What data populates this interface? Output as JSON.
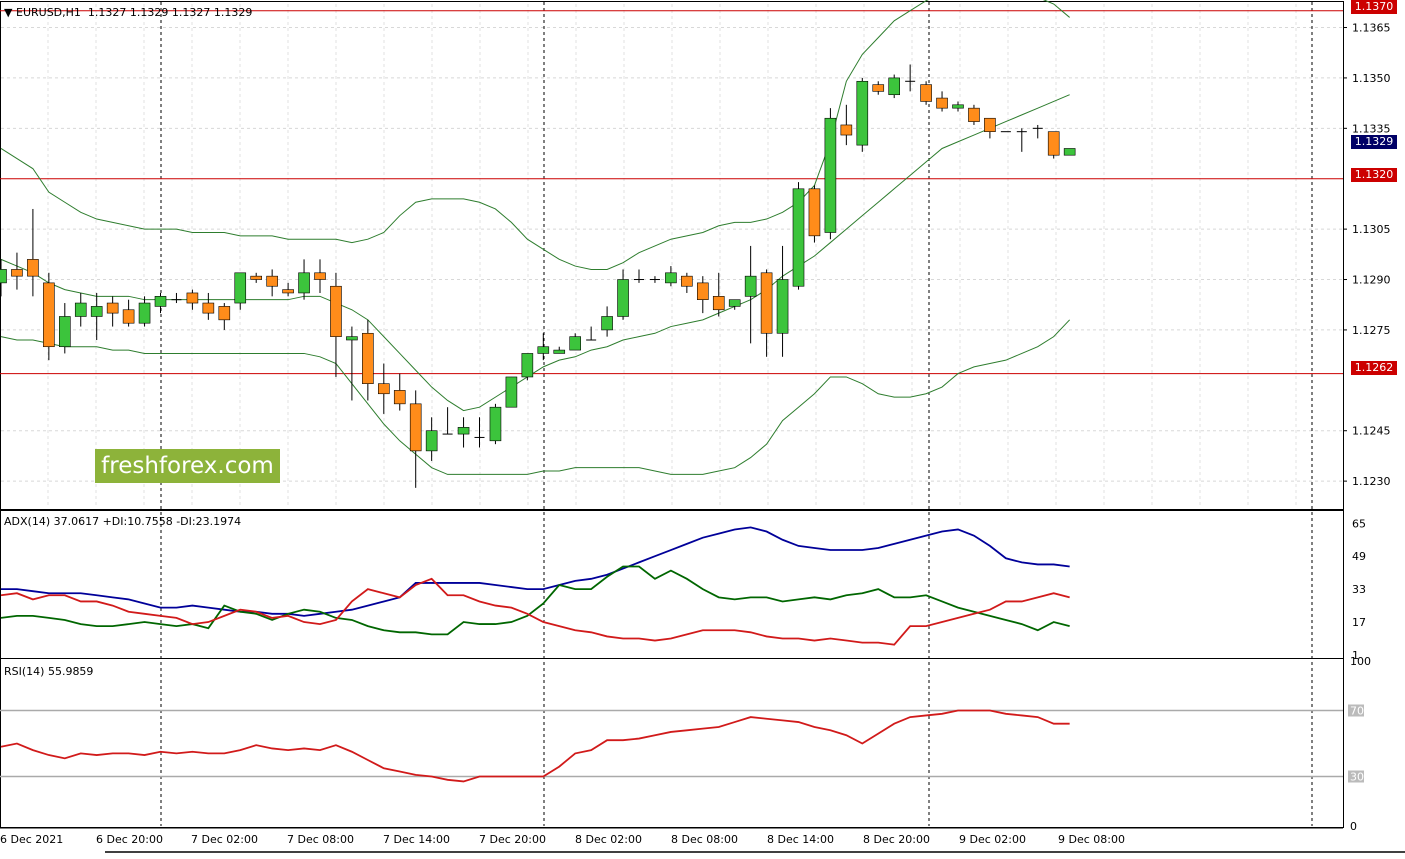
{
  "header": {
    "symbol_line": "EURUSD,H1  1.1327 1.1329 1.1327 1.1329",
    "adx_line": "ADX(14) 37.0617 +DI:10.7558 -DI:23.1974",
    "rsi_line": "RSI(14) 55.9859"
  },
  "watermark": "freshforex.com",
  "price_tags": {
    "top": "1.1370",
    "current": "1.1329",
    "resistance": "1.1320",
    "support": "1.1262"
  },
  "colors": {
    "bull": "#3cc43c",
    "bear": "#ff8c1a",
    "band": "#2e7d2e",
    "level": "#cc0000",
    "adx": "#000099",
    "plus_di": "#006600",
    "minus_di": "#d11a1a",
    "rsi": "#d11a1a",
    "current_tag": "#000066"
  },
  "chart_data": [
    {
      "type": "candlestick",
      "symbol": "EURUSD",
      "timeframe": "H1",
      "ylim": [
        1.1222,
        1.1372
      ],
      "yticks": [
        "1.1365",
        "1.1350",
        "1.1335",
        "1.1305",
        "1.1290",
        "1.1275",
        "1.1245",
        "1.1230"
      ],
      "xticks": [
        "6 Dec 2021",
        "6 Dec 20:00",
        "7 Dec 02:00",
        "7 Dec 08:00",
        "7 Dec 14:00",
        "7 Dec 20:00",
        "8 Dec 02:00",
        "8 Dec 08:00",
        "8 Dec 14:00",
        "8 Dec 20:00",
        "9 Dec 02:00",
        "9 Dec 08:00"
      ],
      "levels": [
        1.137,
        1.132,
        1.1262
      ],
      "candles": [
        [
          1.1289,
          1.1296,
          1.1285,
          1.1293
        ],
        [
          1.1293,
          1.1298,
          1.1287,
          1.1291
        ],
        [
          1.1296,
          1.1311,
          1.1285,
          1.1291
        ],
        [
          1.1289,
          1.1292,
          1.1266,
          1.127
        ],
        [
          1.127,
          1.1283,
          1.1268,
          1.1279
        ],
        [
          1.1279,
          1.1286,
          1.1276,
          1.1283
        ],
        [
          1.1279,
          1.1286,
          1.1272,
          1.1282
        ],
        [
          1.1283,
          1.1285,
          1.1276,
          1.128
        ],
        [
          1.1281,
          1.1284,
          1.1276,
          1.1277
        ],
        [
          1.1277,
          1.1285,
          1.1276,
          1.1283
        ],
        [
          1.1282,
          1.1286,
          1.128,
          1.1285
        ],
        [
          1.1284,
          1.1286,
          1.1283,
          1.1284
        ],
        [
          1.1286,
          1.1287,
          1.1281,
          1.1283
        ],
        [
          1.1283,
          1.1286,
          1.1278,
          1.128
        ],
        [
          1.1282,
          1.1283,
          1.1275,
          1.1278
        ],
        [
          1.1283,
          1.1292,
          1.1281,
          1.1292
        ],
        [
          1.1291,
          1.1292,
          1.1289,
          1.129
        ],
        [
          1.1291,
          1.1293,
          1.1285,
          1.1288
        ],
        [
          1.1287,
          1.1289,
          1.1285,
          1.1286
        ],
        [
          1.1286,
          1.1296,
          1.1284,
          1.1292
        ],
        [
          1.1292,
          1.1296,
          1.1286,
          1.129
        ],
        [
          1.1288,
          1.1292,
          1.1261,
          1.1273
        ],
        [
          1.1272,
          1.1276,
          1.1254,
          1.1273
        ],
        [
          1.1274,
          1.1278,
          1.1254,
          1.1259
        ],
        [
          1.1259,
          1.1265,
          1.125,
          1.1256
        ],
        [
          1.1257,
          1.1262,
          1.1251,
          1.1253
        ],
        [
          1.1253,
          1.1257,
          1.1228,
          1.1239
        ],
        [
          1.1239,
          1.1249,
          1.1236,
          1.1245
        ],
        [
          1.1244,
          1.1252,
          1.1244,
          1.1244
        ],
        [
          1.1244,
          1.1249,
          1.124,
          1.1246
        ],
        [
          1.1243,
          1.1249,
          1.124,
          1.1243
        ],
        [
          1.1242,
          1.1253,
          1.1241,
          1.1252
        ],
        [
          1.1252,
          1.1261,
          1.1252,
          1.1261
        ],
        [
          1.1261,
          1.1268,
          1.126,
          1.1268
        ],
        [
          1.1268,
          1.1274,
          1.1266,
          1.127
        ],
        [
          1.1268,
          1.127,
          1.1268,
          1.1269
        ],
        [
          1.1269,
          1.1274,
          1.1269,
          1.1273
        ],
        [
          1.1272,
          1.1276,
          1.1272,
          1.1272
        ],
        [
          1.1275,
          1.1282,
          1.1273,
          1.1279
        ],
        [
          1.1279,
          1.1293,
          1.1278,
          1.129
        ],
        [
          1.129,
          1.1293,
          1.1289,
          1.129
        ],
        [
          1.129,
          1.1291,
          1.1289,
          1.129
        ],
        [
          1.1289,
          1.1294,
          1.1288,
          1.1292
        ],
        [
          1.1291,
          1.1292,
          1.1286,
          1.1288
        ],
        [
          1.1289,
          1.1291,
          1.128,
          1.1284
        ],
        [
          1.1285,
          1.1292,
          1.1279,
          1.1281
        ],
        [
          1.1282,
          1.1284,
          1.1281,
          1.1284
        ],
        [
          1.1285,
          1.13,
          1.1271,
          1.1291
        ],
        [
          1.1292,
          1.1293,
          1.1267,
          1.1274
        ],
        [
          1.1274,
          1.13,
          1.1267,
          1.129
        ],
        [
          1.1288,
          1.1319,
          1.1287,
          1.1317
        ],
        [
          1.1317,
          1.1318,
          1.1301,
          1.1303
        ],
        [
          1.1304,
          1.1341,
          1.1302,
          1.1338
        ],
        [
          1.1336,
          1.1342,
          1.133,
          1.1333
        ],
        [
          1.133,
          1.135,
          1.1328,
          1.1349
        ],
        [
          1.1348,
          1.1349,
          1.1345,
          1.1346
        ],
        [
          1.1345,
          1.1351,
          1.1344,
          1.135
        ],
        [
          1.1349,
          1.1354,
          1.1346,
          1.1349
        ],
        [
          1.1348,
          1.1349,
          1.1342,
          1.1343
        ],
        [
          1.1344,
          1.1346,
          1.134,
          1.1341
        ],
        [
          1.1341,
          1.1343,
          1.134,
          1.1342
        ],
        [
          1.1341,
          1.1342,
          1.1336,
          1.1337
        ],
        [
          1.1338,
          1.1338,
          1.1332,
          1.1334
        ],
        [
          1.1334,
          1.1334,
          1.1334,
          1.1334
        ],
        [
          1.1334,
          1.1335,
          1.1328,
          1.1334
        ],
        [
          1.1335,
          1.1336,
          1.1332,
          1.1335
        ],
        [
          1.1334,
          1.1334,
          1.1326,
          1.1327
        ],
        [
          1.1327,
          1.1329,
          1.1327,
          1.1329
        ]
      ],
      "bollinger": {
        "upper": [
          1.1329,
          1.1326,
          1.1323,
          1.1316,
          1.1313,
          1.131,
          1.1308,
          1.1307,
          1.1306,
          1.1305,
          1.1305,
          1.1305,
          1.1304,
          1.1304,
          1.1304,
          1.1303,
          1.1303,
          1.1303,
          1.1302,
          1.1302,
          1.1302,
          1.1302,
          1.1301,
          1.1302,
          1.1304,
          1.1309,
          1.1313,
          1.1314,
          1.1314,
          1.1314,
          1.1313,
          1.1311,
          1.1307,
          1.1302,
          1.1299,
          1.1296,
          1.1294,
          1.1293,
          1.1293,
          1.1295,
          1.1298,
          1.13,
          1.1302,
          1.1303,
          1.1304,
          1.1306,
          1.1307,
          1.1307,
          1.1308,
          1.131,
          1.1313,
          1.1318,
          1.1331,
          1.1349,
          1.1357,
          1.1362,
          1.1367,
          1.137,
          1.1373,
          1.1375,
          1.1376,
          1.1377,
          1.1377,
          1.1377,
          1.1376,
          1.1374,
          1.1372,
          1.1368
        ],
        "middle": [
          1.1296,
          1.1294,
          1.1292,
          1.1289,
          1.1287,
          1.1286,
          1.1285,
          1.1285,
          1.1285,
          1.1284,
          1.1284,
          1.1284,
          1.1284,
          1.1284,
          1.1284,
          1.1284,
          1.1284,
          1.1284,
          1.1284,
          1.1285,
          1.1285,
          1.1283,
          1.1281,
          1.1278,
          1.1273,
          1.1268,
          1.1263,
          1.1258,
          1.1254,
          1.1251,
          1.1252,
          1.1255,
          1.1258,
          1.1261,
          1.1264,
          1.1266,
          1.1267,
          1.1269,
          1.127,
          1.1272,
          1.1273,
          1.1274,
          1.1276,
          1.1277,
          1.1278,
          1.128,
          1.1282,
          1.1284,
          1.1287,
          1.1291,
          1.1294,
          1.1297,
          1.1301,
          1.1305,
          1.1309,
          1.1313,
          1.1317,
          1.1321,
          1.1325,
          1.1329,
          1.1331,
          1.1333,
          1.1335,
          1.1337,
          1.1339,
          1.1341,
          1.1343,
          1.1345
        ],
        "lower": [
          1.1273,
          1.1272,
          1.1272,
          1.1271,
          1.127,
          1.127,
          1.127,
          1.1269,
          1.1269,
          1.1268,
          1.1268,
          1.1268,
          1.1268,
          1.1268,
          1.1268,
          1.1268,
          1.1268,
          1.1268,
          1.1268,
          1.1268,
          1.1267,
          1.1265,
          1.1259,
          1.1253,
          1.1247,
          1.1242,
          1.1238,
          1.1234,
          1.1232,
          1.1232,
          1.1232,
          1.1232,
          1.1232,
          1.1232,
          1.1233,
          1.1233,
          1.1234,
          1.1234,
          1.1234,
          1.1234,
          1.1234,
          1.1233,
          1.1232,
          1.1232,
          1.1232,
          1.1233,
          1.1234,
          1.1237,
          1.1241,
          1.1248,
          1.1252,
          1.1256,
          1.1261,
          1.1261,
          1.1259,
          1.1256,
          1.1255,
          1.1255,
          1.1256,
          1.1258,
          1.1262,
          1.1264,
          1.1265,
          1.1266,
          1.1268,
          1.127,
          1.1273,
          1.1278
        ]
      }
    },
    {
      "type": "line",
      "title": "ADX(14)",
      "ylim": [
        0,
        70
      ],
      "yticks": [
        65,
        49,
        33,
        17,
        1
      ],
      "series": [
        {
          "name": "ADX",
          "values": [
            33,
            33,
            32,
            31,
            31,
            31,
            30,
            29,
            28,
            26,
            24,
            24,
            25,
            24,
            23,
            22,
            22,
            21,
            21,
            20,
            21,
            22,
            23,
            25,
            27,
            29,
            36,
            36,
            36,
            36,
            36,
            35,
            34,
            33,
            33,
            35,
            37,
            38,
            40,
            43,
            46,
            49,
            52,
            55,
            58,
            60,
            62,
            63,
            61,
            57,
            54,
            53,
            52,
            52,
            52,
            53,
            55,
            57,
            59,
            61,
            62,
            59,
            54,
            48,
            46,
            45,
            45,
            44
          ]
        },
        {
          "name": "+DI",
          "values": [
            19,
            20,
            20,
            19,
            18,
            16,
            15,
            15,
            16,
            17,
            16,
            15,
            16,
            14,
            25,
            22,
            21,
            18,
            21,
            23,
            22,
            19,
            18,
            15,
            13,
            12,
            12,
            11,
            11,
            17,
            16,
            16,
            17,
            20,
            26,
            35,
            33,
            33,
            39,
            44,
            44,
            38,
            42,
            38,
            33,
            29,
            28,
            29,
            29,
            27,
            28,
            29,
            28,
            30,
            31,
            33,
            29,
            29,
            30,
            27,
            24,
            22,
            20,
            18,
            16,
            13,
            17,
            15
          ]
        },
        {
          "name": "-DI",
          "values": [
            30,
            31,
            28,
            30,
            30,
            27,
            27,
            25,
            22,
            21,
            20,
            19,
            16,
            17,
            20,
            23,
            22,
            19,
            20,
            17,
            16,
            18,
            27,
            33,
            31,
            29,
            35,
            38,
            30,
            30,
            27,
            25,
            24,
            21,
            17,
            15,
            13,
            12,
            10,
            9,
            9,
            8,
            9,
            11,
            13,
            13,
            13,
            12,
            10,
            9,
            9,
            8,
            9,
            8,
            7,
            7,
            6,
            15,
            15,
            17,
            19,
            21,
            23,
            27,
            27,
            29,
            31,
            29
          ]
        }
      ]
    },
    {
      "type": "line",
      "title": "RSI(14)",
      "ylim": [
        0,
        100
      ],
      "yticks": [
        100,
        70,
        30,
        0
      ],
      "reference_lines": [
        70,
        30
      ],
      "series": [
        {
          "name": "RSI",
          "values": [
            48,
            50,
            46,
            43,
            41,
            44,
            43,
            44,
            44,
            43,
            45,
            44,
            45,
            44,
            44,
            46,
            49,
            47,
            46,
            47,
            46,
            49,
            45,
            40,
            35,
            33,
            31,
            30,
            28,
            27,
            30,
            30,
            30,
            30,
            30,
            36,
            44,
            46,
            52,
            52,
            53,
            55,
            57,
            58,
            59,
            60,
            63,
            66,
            65,
            64,
            63,
            60,
            58,
            55,
            50,
            56,
            62,
            66,
            67,
            68,
            70,
            70,
            70,
            68,
            67,
            66,
            62,
            62
          ]
        }
      ]
    }
  ]
}
